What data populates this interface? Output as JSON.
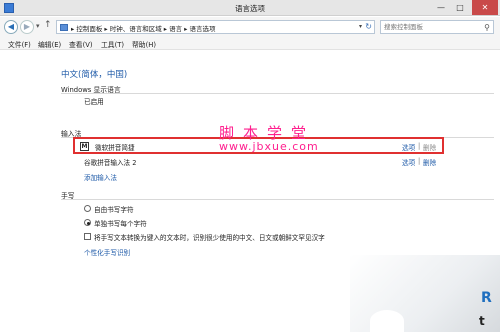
{
  "window": {
    "title": "语言选项",
    "controls": {
      "minimize": "—",
      "maximize": "□",
      "close": "✕"
    }
  },
  "address": {
    "crumbs": "▸ 控制面板  ▸  时钟、语言和区域  ▸  语言  ▸  语言选项",
    "up": "↑",
    "search_placeholder": "搜索控制面板"
  },
  "menu": {
    "items": [
      "文件(F)",
      "编辑(E)",
      "查看(V)",
      "工具(T)",
      "帮助(H)"
    ]
  },
  "content": {
    "heading": "中文(简体，中国)",
    "display_language": {
      "title": "Windows 显示语言",
      "status": "已启用"
    },
    "input_methods": {
      "title": "输入法",
      "items": [
        {
          "name": "微软拼音简捷",
          "icon_letter": "M",
          "options": "选项",
          "delete": "删除"
        },
        {
          "name": "谷歌拼音输入法 2",
          "options": "选项",
          "delete": "删除"
        }
      ],
      "separator": "|",
      "add_link": "添加输入法"
    },
    "handwriting": {
      "title": "手写",
      "radio1": "自由书写字符",
      "radio2": "单独书写每个字符",
      "radio_selected": 2,
      "checkbox": "将手写文本转换为键入的文本时，识别很少使用的中文、日文或朝鲜文罕见汉字",
      "checkbox_checked": false,
      "personalize_link": "个性化手写识别"
    }
  },
  "watermark": {
    "line1": "脚本学堂",
    "line2": "www.jbxue.com"
  },
  "corner": {
    "logo_top": "R",
    "logo_bottom": "t"
  },
  "colors": {
    "link": "#1e5aa8",
    "highlight_box": "#e03030",
    "watermark": "#ff1f8e"
  }
}
